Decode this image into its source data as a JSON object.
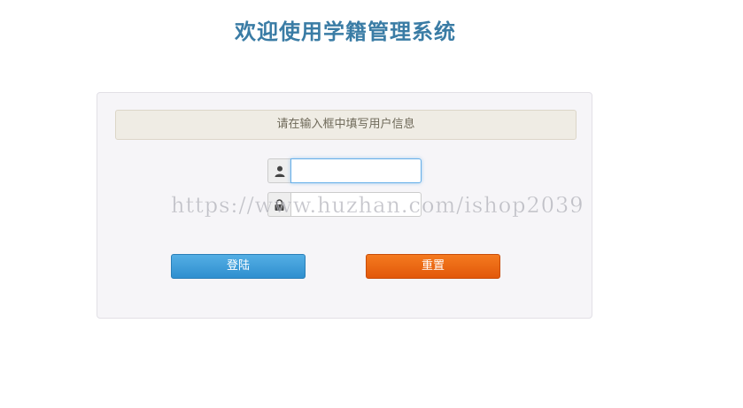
{
  "header": {
    "title": "欢迎使用学籍管理系统"
  },
  "login_panel": {
    "notice": "请在输入框中填写用户信息",
    "username": {
      "icon": "user-icon",
      "value": "",
      "placeholder": ""
    },
    "password": {
      "icon": "lock-icon",
      "value": "",
      "placeholder": ""
    },
    "login_label": "登陆",
    "reset_label": "重置"
  },
  "watermark": {
    "text": "https://www.huzhan.com/ishop2039"
  },
  "colors": {
    "title": "#3a7ca5",
    "login_button": "#3b9ad9",
    "reset_button": "#eb6410",
    "notice_bg": "#efece4"
  }
}
